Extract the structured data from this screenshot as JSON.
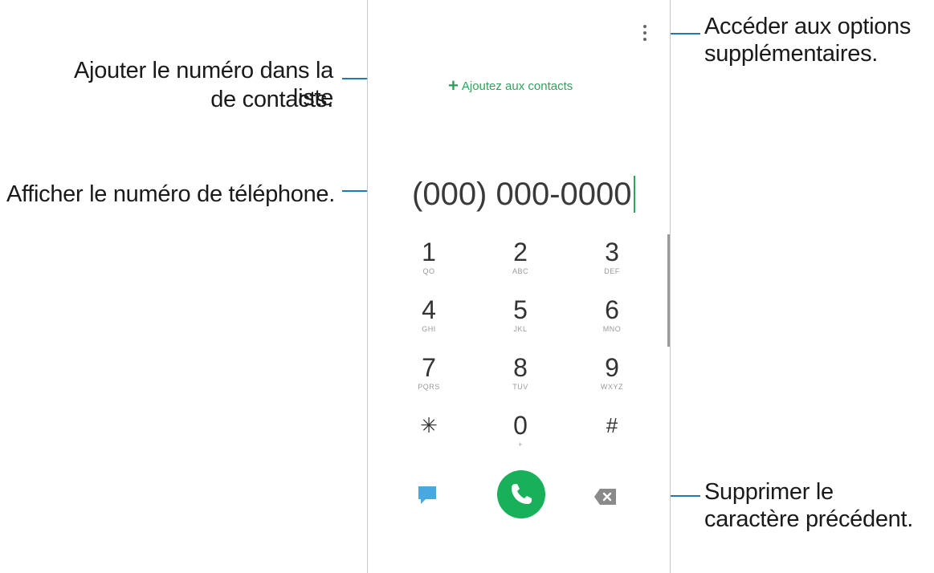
{
  "annotations": {
    "options": "Accéder aux options supplémentaires.",
    "add_contact_line1": "Ajouter le numéro dans la liste",
    "add_contact_line2": "de contacts.",
    "display_number": "Afficher le numéro de téléphone.",
    "delete": "Supprimer le caractère précédent."
  },
  "phone": {
    "add_contact_label": "Ajoutez aux contacts",
    "number": "(000) 000-0000",
    "keypad": [
      {
        "digit": "1",
        "letters": "QO"
      },
      {
        "digit": "2",
        "letters": "ABC"
      },
      {
        "digit": "3",
        "letters": "DEF"
      },
      {
        "digit": "4",
        "letters": "GHI"
      },
      {
        "digit": "5",
        "letters": "JKL"
      },
      {
        "digit": "6",
        "letters": "MNO"
      },
      {
        "digit": "7",
        "letters": "PQRS"
      },
      {
        "digit": "8",
        "letters": "TUV"
      },
      {
        "digit": "9",
        "letters": "WXYZ"
      },
      {
        "digit": "✳",
        "letters": ""
      },
      {
        "digit": "0",
        "letters": "+"
      },
      {
        "digit": "#",
        "letters": ""
      }
    ],
    "icons": {
      "menu": "more-vert-icon",
      "message": "message-icon",
      "call": "phone-icon",
      "backspace": "backspace-icon"
    },
    "colors": {
      "accent": "#2fa35c",
      "call": "#18b15a",
      "message": "#4aa8e0",
      "leader": "#1f77b4"
    }
  }
}
